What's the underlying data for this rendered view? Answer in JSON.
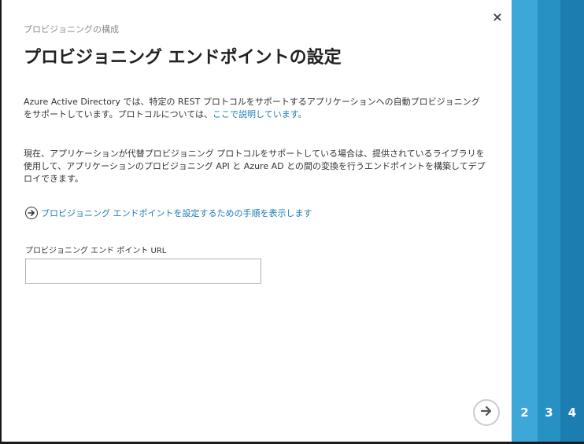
{
  "breadcrumb": "プロビジョニングの構成",
  "title": "プロビジョニング エンドポイントの設定",
  "paragraph1": {
    "text": "Azure Active Directory では、特定の REST プロトコルをサポートするアプリケーションへの自動プロビジョニングをサポートしています。プロトコルについては、",
    "link": "ここで説明しています。"
  },
  "paragraph2": "現在、アプリケーションが代替プロビジョニング プロトコルをサポートしている場合は、提供されているライブラリを使用して、アプリケーションのプロビジョニング API と Azure AD との間の変換を行うエンドポイントを構築してデプロイできます。",
  "instructions_link": "プロビジョニング エンドポイントを設定するための手順を表示します",
  "field": {
    "label": "プロビジョニング エンド ポイント URL",
    "value": "",
    "placeholder": ""
  },
  "close_label": "×",
  "steps": [
    "2",
    "3",
    "4"
  ],
  "colors": {
    "step2": "#3da7d8",
    "step3": "#2891c4",
    "step4": "#1c7db0",
    "link": "#1a7cb3"
  },
  "icons": {
    "close": "close-icon",
    "instructions": "arrow-right-circle-icon",
    "next": "arrow-right-circle-icon"
  }
}
